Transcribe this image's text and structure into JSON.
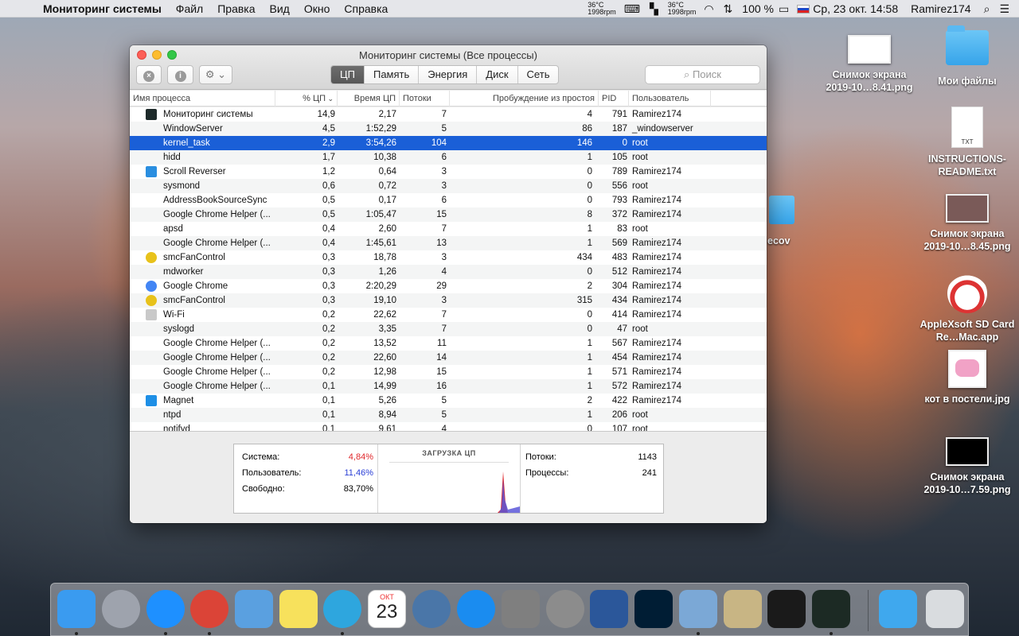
{
  "menubar": {
    "apple": "",
    "app_name": "Мониторинг системы",
    "menus": [
      "Файл",
      "Правка",
      "Вид",
      "Окно",
      "Справка"
    ],
    "temp1": "36°C",
    "rpm1": "1998rpm",
    "temp2": "36°C",
    "rpm2": "1998rpm",
    "battery": "100 %",
    "input_badge": "PC",
    "datetime": "Ср, 23 окт.  14:58",
    "user": "Ramirez174"
  },
  "desktop": {
    "icons": [
      {
        "label": "Снимок экрана 2019-10…8.41.png",
        "kind": "screenshot"
      },
      {
        "label": "Мои файлы",
        "kind": "folder"
      },
      {
        "label": "INSTRUCTIONS-README.txt",
        "kind": "text",
        "badge": "TXT"
      },
      {
        "label": "Снимок экрана 2019-10…8.45.png",
        "kind": "screenshot"
      },
      {
        "label": "AppleXsoft SD Card Re…Mac.app",
        "kind": "app"
      },
      {
        "label": "кот в постели.jpg",
        "kind": "image"
      },
      {
        "label": "Снимок экрана 2019-10…7.59.png",
        "kind": "screenshot"
      }
    ],
    "partial_label": "ecov"
  },
  "window": {
    "title": "Мониторинг системы (Все процессы)",
    "tabs": [
      {
        "label": "ЦП",
        "active": true
      },
      {
        "label": "Память",
        "active": false
      },
      {
        "label": "Энергия",
        "active": false
      },
      {
        "label": "Диск",
        "active": false
      },
      {
        "label": "Сеть",
        "active": false
      }
    ],
    "search_placeholder": "Поиск",
    "info_glyph": "i",
    "close_glyph": "×",
    "gear_glyph": "⚙ ⌄",
    "columns": {
      "name": "Имя процесса",
      "cpu": "% ЦП",
      "time": "Время ЦП",
      "threads": "Потоки",
      "wakeups": "Пробуждение из простоя",
      "pid": "PID",
      "user": "Пользователь"
    },
    "processes": [
      {
        "name": "Мониторинг системы",
        "cpu": "14,9",
        "time": "2,17",
        "threads": "7",
        "wakeups": "4",
        "pid": "791",
        "user": "Ramirez174",
        "icon": "activity-monitor-icon",
        "icon_color": "#1d2a2a"
      },
      {
        "name": "WindowServer",
        "cpu": "4,5",
        "time": "1:52,29",
        "threads": "5",
        "wakeups": "86",
        "pid": "187",
        "user": "_windowserver"
      },
      {
        "name": "kernel_task",
        "cpu": "2,9",
        "time": "3:54,26",
        "threads": "104",
        "wakeups": "146",
        "pid": "0",
        "user": "root",
        "selected": true
      },
      {
        "name": "hidd",
        "cpu": "1,7",
        "time": "10,38",
        "threads": "6",
        "wakeups": "1",
        "pid": "105",
        "user": "root"
      },
      {
        "name": "Scroll Reverser",
        "cpu": "1,2",
        "time": "0,64",
        "threads": "3",
        "wakeups": "0",
        "pid": "789",
        "user": "Ramirez174",
        "icon": "scroll-reverser-icon",
        "icon_color": "#2a8ee0"
      },
      {
        "name": "sysmond",
        "cpu": "0,6",
        "time": "0,72",
        "threads": "3",
        "wakeups": "0",
        "pid": "556",
        "user": "root"
      },
      {
        "name": "AddressBookSourceSync",
        "cpu": "0,5",
        "time": "0,17",
        "threads": "6",
        "wakeups": "0",
        "pid": "793",
        "user": "Ramirez174"
      },
      {
        "name": "Google Chrome Helper (...",
        "cpu": "0,5",
        "time": "1:05,47",
        "threads": "15",
        "wakeups": "8",
        "pid": "372",
        "user": "Ramirez174"
      },
      {
        "name": "apsd",
        "cpu": "0,4",
        "time": "2,60",
        "threads": "7",
        "wakeups": "1",
        "pid": "83",
        "user": "root"
      },
      {
        "name": "Google Chrome Helper (...",
        "cpu": "0,4",
        "time": "1:45,61",
        "threads": "13",
        "wakeups": "1",
        "pid": "569",
        "user": "Ramirez174"
      },
      {
        "name": "smcFanControl",
        "cpu": "0,3",
        "time": "18,78",
        "threads": "3",
        "wakeups": "434",
        "pid": "483",
        "user": "Ramirez174",
        "icon": "radiation-icon",
        "icon_color": "#e8c21b"
      },
      {
        "name": "mdworker",
        "cpu": "0,3",
        "time": "1,26",
        "threads": "4",
        "wakeups": "0",
        "pid": "512",
        "user": "Ramirez174"
      },
      {
        "name": "Google Chrome",
        "cpu": "0,3",
        "time": "2:20,29",
        "threads": "29",
        "wakeups": "2",
        "pid": "304",
        "user": "Ramirez174",
        "icon": "chrome-icon",
        "icon_color": "#4285f4"
      },
      {
        "name": "smcFanControl",
        "cpu": "0,3",
        "time": "19,10",
        "threads": "3",
        "wakeups": "315",
        "pid": "434",
        "user": "Ramirez174",
        "icon": "radiation-icon",
        "icon_color": "#e8c21b"
      },
      {
        "name": "Wi-Fi",
        "cpu": "0,2",
        "time": "22,62",
        "threads": "7",
        "wakeups": "0",
        "pid": "414",
        "user": "Ramirez174",
        "icon": "wifi-app-icon",
        "icon_color": "#c9c9c9"
      },
      {
        "name": "syslogd",
        "cpu": "0,2",
        "time": "3,35",
        "threads": "7",
        "wakeups": "0",
        "pid": "47",
        "user": "root"
      },
      {
        "name": "Google Chrome Helper (...",
        "cpu": "0,2",
        "time": "13,52",
        "threads": "11",
        "wakeups": "1",
        "pid": "567",
        "user": "Ramirez174"
      },
      {
        "name": "Google Chrome Helper (...",
        "cpu": "0,2",
        "time": "22,60",
        "threads": "14",
        "wakeups": "1",
        "pid": "454",
        "user": "Ramirez174"
      },
      {
        "name": "Google Chrome Helper (...",
        "cpu": "0,2",
        "time": "12,98",
        "threads": "15",
        "wakeups": "1",
        "pid": "571",
        "user": "Ramirez174"
      },
      {
        "name": "Google Chrome Helper (...",
        "cpu": "0,1",
        "time": "14,99",
        "threads": "16",
        "wakeups": "1",
        "pid": "572",
        "user": "Ramirez174"
      },
      {
        "name": "Magnet",
        "cpu": "0,1",
        "time": "5,26",
        "threads": "5",
        "wakeups": "2",
        "pid": "422",
        "user": "Ramirez174",
        "icon": "magnet-icon",
        "icon_color": "#1e8fe6"
      },
      {
        "name": "ntpd",
        "cpu": "0,1",
        "time": "8,94",
        "threads": "5",
        "wakeups": "1",
        "pid": "206",
        "user": "root"
      },
      {
        "name": "notifyd",
        "cpu": "0,1",
        "time": "9,61",
        "threads": "4",
        "wakeups": "0",
        "pid": "107",
        "user": "root"
      }
    ],
    "stats": {
      "system_label": "Система:",
      "system_value": "4,84%",
      "user_label": "Пользователь:",
      "user_value": "11,46%",
      "idle_label": "Свободно:",
      "idle_value": "83,70%",
      "cpu_load_label": "ЗАГРУЗКА ЦП",
      "threads_label": "Потоки:",
      "threads_value": "1143",
      "processes_label": "Процессы:",
      "processes_value": "241",
      "system_color": "#e0282c",
      "user_color": "#2a3fd6"
    }
  },
  "dock": {
    "items": [
      {
        "name": "finder",
        "color": "#3a9bf0",
        "running": true
      },
      {
        "name": "launchpad",
        "color": "#9ea3ad",
        "running": false
      },
      {
        "name": "safari",
        "color": "#1e90ff",
        "running": true
      },
      {
        "name": "chrome",
        "color": "#db4437",
        "running": true
      },
      {
        "name": "mail",
        "color": "#5aa0e0",
        "running": false
      },
      {
        "name": "notes",
        "color": "#f7e15c",
        "running": false
      },
      {
        "name": "telegram",
        "color": "#2ea6de",
        "running": true
      },
      {
        "name": "calendar",
        "color": "#ffffff",
        "running": false
      },
      {
        "name": "vk",
        "color": "#4a76a8",
        "running": false
      },
      {
        "name": "app-store",
        "color": "#1a8cf0",
        "running": false
      },
      {
        "name": "calculator",
        "color": "#7f7f7f",
        "running": false
      },
      {
        "name": "system-preferences",
        "color": "#8c8c8c",
        "running": false
      },
      {
        "name": "word",
        "color": "#2b579a",
        "running": false
      },
      {
        "name": "photoshop",
        "color": "#001d34",
        "running": false
      },
      {
        "name": "preview",
        "color": "#7ba8d6",
        "running": true
      },
      {
        "name": "mahjong",
        "color": "#c8b584",
        "running": false
      },
      {
        "name": "sd-card-recovery",
        "color": "#1a1a1a",
        "running": false
      },
      {
        "name": "activity-monitor",
        "color": "#1c2a24",
        "running": true
      },
      {
        "name": "downloads-folder",
        "color": "#3fa8ee",
        "running": false
      },
      {
        "name": "trash",
        "color": "#d9dcdf",
        "running": false
      }
    ],
    "calendar_month": "ОКТ",
    "calendar_day": "23"
  }
}
